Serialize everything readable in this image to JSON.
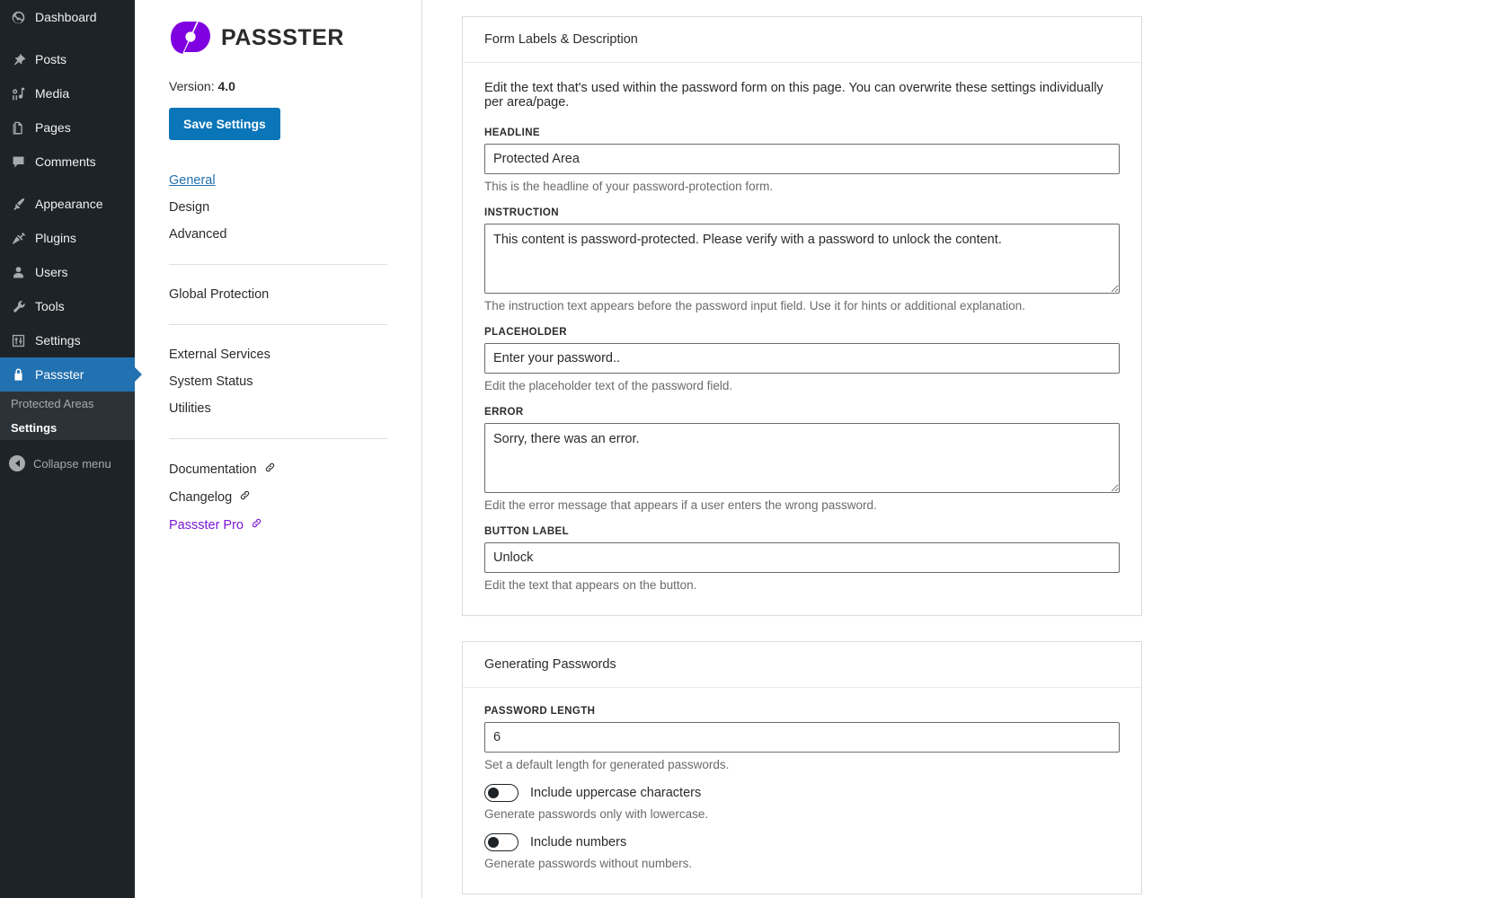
{
  "wp_sidebar": {
    "items": [
      {
        "label": "Dashboard",
        "icon": "dashboard-icon"
      },
      {
        "label": "Posts",
        "icon": "pin-icon"
      },
      {
        "label": "Media",
        "icon": "media-icon"
      },
      {
        "label": "Pages",
        "icon": "pages-icon"
      },
      {
        "label": "Comments",
        "icon": "comments-icon"
      },
      {
        "label": "Appearance",
        "icon": "brush-icon"
      },
      {
        "label": "Plugins",
        "icon": "plug-icon"
      },
      {
        "label": "Users",
        "icon": "user-icon"
      },
      {
        "label": "Tools",
        "icon": "wrench-icon"
      },
      {
        "label": "Settings",
        "icon": "sliders-icon"
      },
      {
        "label": "Passster",
        "icon": "lock-icon"
      }
    ],
    "submenu": [
      {
        "label": "Protected Areas",
        "current": false
      },
      {
        "label": "Settings",
        "current": true
      }
    ],
    "collapse_label": "Collapse menu",
    "active_color": "#2271b1"
  },
  "plugin_nav": {
    "logo_text": "PASSSTER",
    "logo_color": "#7f00e0",
    "version_label": "Version:",
    "version_value": "4.0",
    "save_label": "Save Settings",
    "save_color": "#0a75b8",
    "group_1": [
      {
        "label": "General",
        "active": true
      },
      {
        "label": "Design",
        "active": false
      },
      {
        "label": "Advanced",
        "active": false
      }
    ],
    "group_2": [
      {
        "label": "Global Protection"
      }
    ],
    "group_3": [
      {
        "label": "External Services"
      },
      {
        "label": "System Status"
      },
      {
        "label": "Utilities"
      }
    ],
    "group_4": [
      {
        "label": "Documentation",
        "external": true,
        "pro": false
      },
      {
        "label": "Changelog",
        "external": true,
        "pro": false
      },
      {
        "label": "Passster Pro",
        "external": true,
        "pro": true
      }
    ],
    "pro_color": "#7b16d6"
  },
  "form_labels_card": {
    "title": "Form Labels & Description",
    "intro": "Edit the text that's used within the password form on this page. You can overwrite these settings individually per area/page.",
    "fields": {
      "headline": {
        "label": "HEADLINE",
        "value": "Protected Area",
        "help": "This is the headline of your password-protection form."
      },
      "instruction": {
        "label": "INSTRUCTION",
        "value": "This content is password-protected. Please verify with a password to unlock the content.",
        "help": "The instruction text appears before the password input field. Use it for hints or additional explanation."
      },
      "placeholder": {
        "label": "PLACEHOLDER",
        "value": "Enter your password..",
        "help": "Edit the placeholder text of the password field."
      },
      "error": {
        "label": "ERROR",
        "value": "Sorry, there was an error.",
        "help": "Edit the error message that appears if a user enters the wrong password."
      },
      "button_label": {
        "label": "BUTTON LABEL",
        "value": "Unlock",
        "help": "Edit the text that appears on the button."
      }
    }
  },
  "generating_passwords_card": {
    "title": "Generating Passwords",
    "fields": {
      "password_length": {
        "label": "PASSWORD LENGTH",
        "value": "6",
        "help": "Set a default length for generated passwords."
      },
      "include_uppercase": {
        "label": "Include uppercase characters",
        "state": "off",
        "help": "Generate passwords only with lowercase."
      },
      "include_numbers": {
        "label": "Include numbers",
        "state": "off",
        "help": "Generate passwords without numbers."
      }
    }
  }
}
